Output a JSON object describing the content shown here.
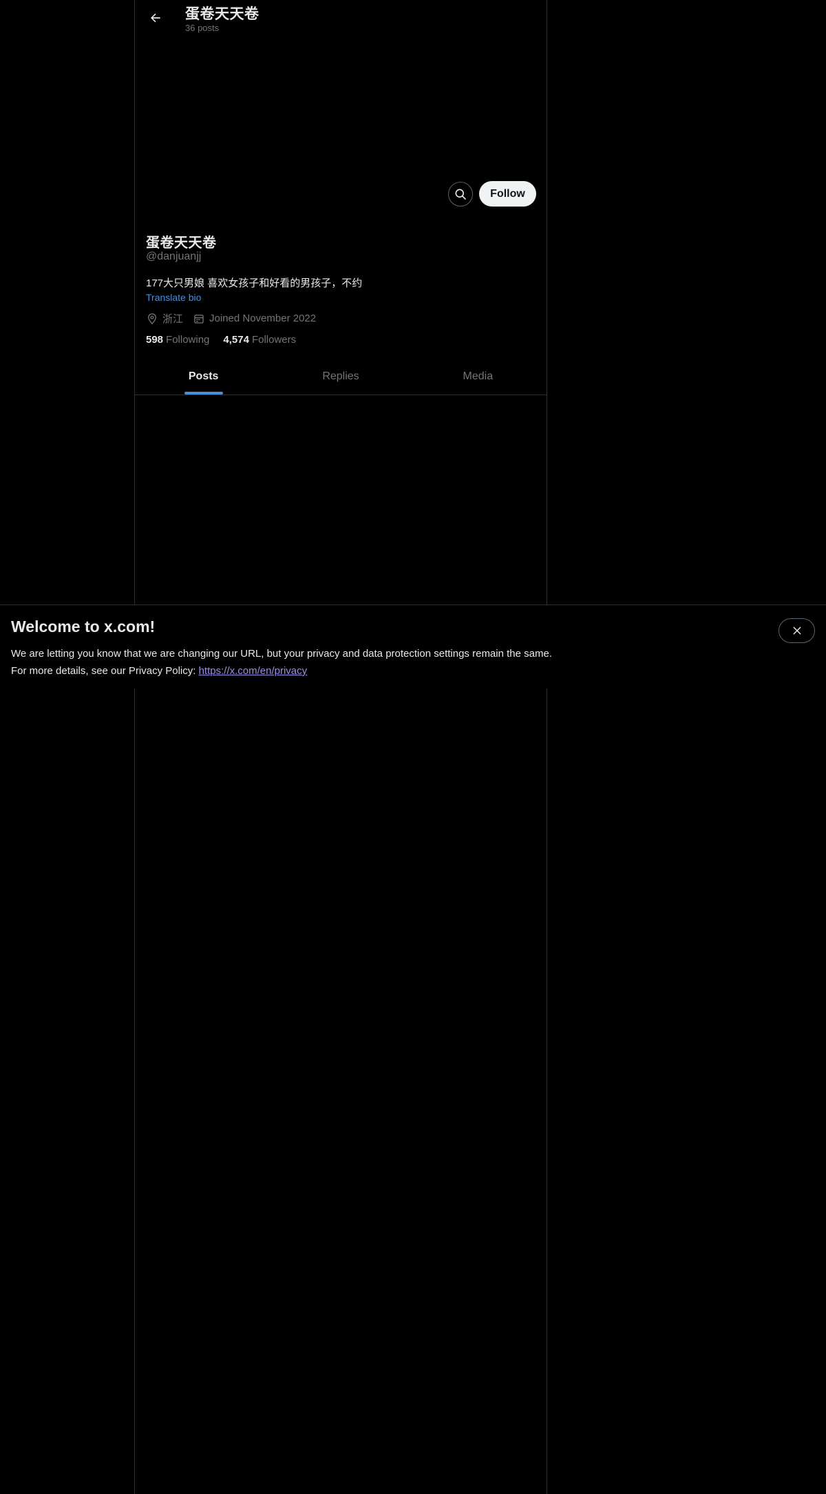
{
  "header": {
    "title": "蛋卷天天卷",
    "post_count": "36 posts"
  },
  "actions": {
    "follow_label": "Follow"
  },
  "profile": {
    "display_name": "蛋卷天天卷",
    "handle": "@danjuanjj",
    "bio": "177大只男娘 喜欢女孩子和好看的男孩子，不约",
    "translate_label": "Translate bio",
    "location": "浙江",
    "joined": "Joined November 2022",
    "following_count": "598",
    "following_label": "Following",
    "followers_count": "4,574",
    "followers_label": "Followers"
  },
  "tabs": [
    {
      "label": "Posts",
      "active": true
    },
    {
      "label": "Replies",
      "active": false
    },
    {
      "label": "Media",
      "active": false
    }
  ],
  "banner": {
    "title": "Welcome to x.com!",
    "line1": "We are letting you know that we are changing our URL, but your privacy and data protection settings remain the same.",
    "line2_prefix": "For more details, see our Privacy Policy: ",
    "link_text": "https://x.com/en/privacy"
  },
  "colors": {
    "background": "#000000",
    "accent": "#4a8fdb",
    "link": "#9a8fe8",
    "muted_text": "#71767b",
    "border": "#2f3336"
  },
  "icons": [
    "back-arrow-icon",
    "search-icon",
    "location-pin-icon",
    "calendar-icon",
    "close-icon"
  ]
}
